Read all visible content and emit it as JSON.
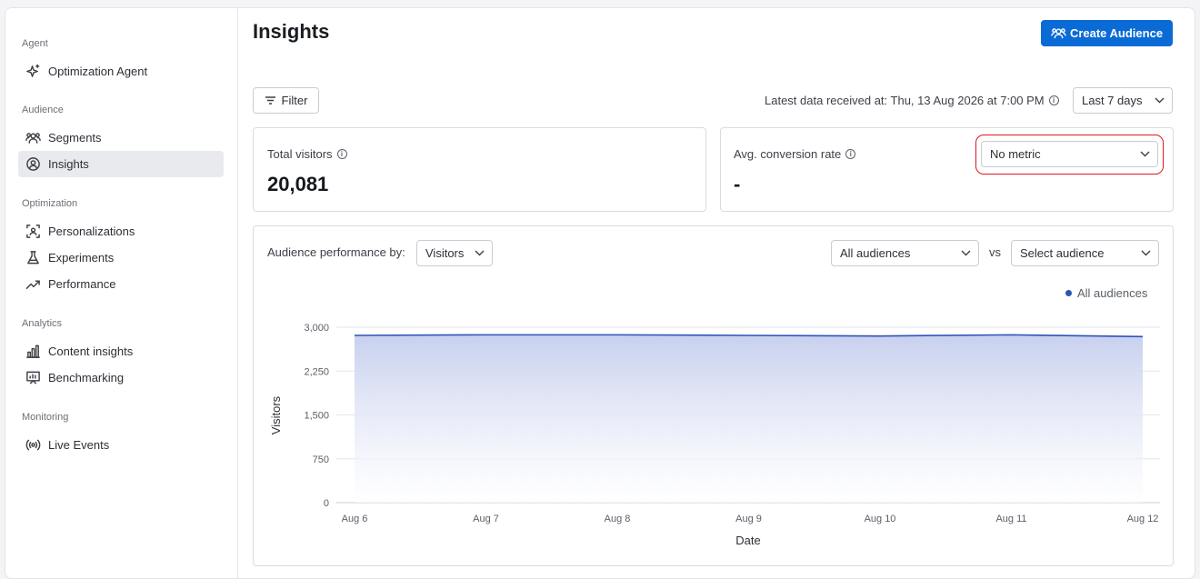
{
  "sidebar": {
    "sections": [
      {
        "label": "Agent",
        "items": [
          {
            "label": "Optimization Agent",
            "icon": "sparkle-icon"
          }
        ]
      },
      {
        "label": "Audience",
        "items": [
          {
            "label": "Segments",
            "icon": "users-icon"
          },
          {
            "label": "Insights",
            "icon": "user-circle-icon",
            "active": true
          }
        ]
      },
      {
        "label": "Optimization",
        "items": [
          {
            "label": "Personalizations",
            "icon": "focus-user-icon"
          },
          {
            "label": "Experiments",
            "icon": "flask-icon"
          },
          {
            "label": "Performance",
            "icon": "trend-icon"
          }
        ]
      },
      {
        "label": "Analytics",
        "items": [
          {
            "label": "Content insights",
            "icon": "bar-chart-icon"
          },
          {
            "label": "Benchmarking",
            "icon": "presentation-icon"
          }
        ]
      },
      {
        "label": "Monitoring",
        "items": [
          {
            "label": "Live Events",
            "icon": "broadcast-icon"
          }
        ]
      }
    ]
  },
  "header": {
    "title": "Insights",
    "create_button": "Create Audience"
  },
  "toolbar": {
    "filter_label": "Filter",
    "latest_text": "Latest data received at: Thu, 13 Aug 2026 at 7:00 PM",
    "range_value": "Last 7 days"
  },
  "cards": {
    "visitors": {
      "label": "Total visitors",
      "value": "20,081"
    },
    "conversion": {
      "label": "Avg. conversion rate",
      "value": "-",
      "metric_select": "No metric"
    }
  },
  "performance": {
    "label": "Audience performance by:",
    "metric_select": "Visitors",
    "audience_select": "All audiences",
    "vs_label": "vs",
    "compare_select": "Select audience",
    "legend": "All audiences"
  },
  "colors": {
    "accent": "#0b6bd6",
    "series": "#2f52b8",
    "highlight": "#e1141e"
  },
  "chart_data": {
    "type": "area",
    "xlabel": "Date",
    "ylabel": "Visitors",
    "categories": [
      "Aug 6",
      "Aug 7",
      "Aug 8",
      "Aug 9",
      "Aug 10",
      "Aug 11",
      "Aug 12"
    ],
    "y_ticks": [
      "3,000",
      "2,250",
      "1,500",
      "750",
      "0"
    ],
    "ylim": [
      0,
      3000
    ],
    "series": [
      {
        "name": "All audiences",
        "values": [
          2860,
          2870,
          2870,
          2860,
          2850,
          2870,
          2840
        ]
      }
    ],
    "grid": true,
    "legend_position": "top-right"
  }
}
